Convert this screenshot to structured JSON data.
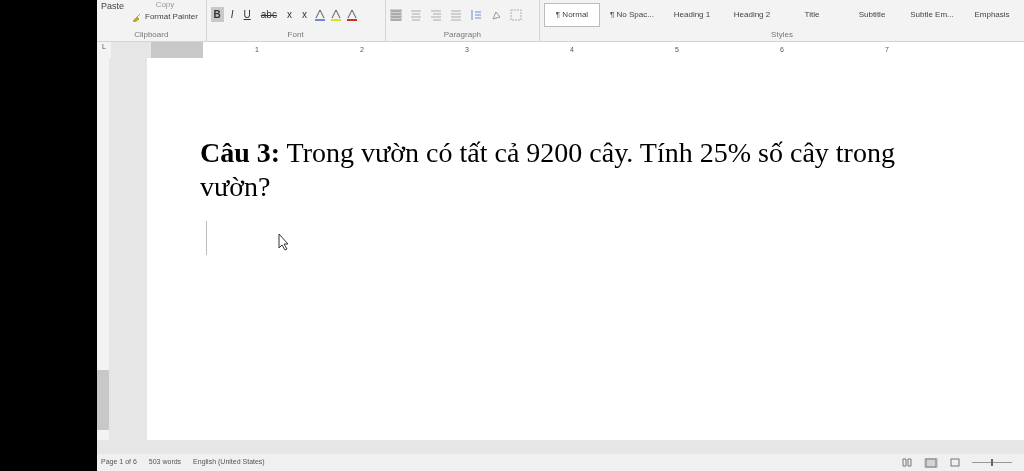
{
  "clipboard": {
    "paste": "Paste",
    "copy": "Copy",
    "format_painter": "Format Painter",
    "label": "Clipboard"
  },
  "font": {
    "buttons": [
      {
        "text": "B",
        "kind": "bold",
        "selected": true
      },
      {
        "text": "I",
        "kind": "italic",
        "selected": false
      },
      {
        "text": "U",
        "kind": "underline",
        "selected": false
      },
      {
        "text": "abc",
        "kind": "strike",
        "selected": false
      },
      {
        "text": "x",
        "kind": "sub",
        "selected": false
      },
      {
        "text": "x",
        "kind": "sup",
        "selected": false
      }
    ],
    "label": "Font"
  },
  "paragraph": {
    "label": "Paragraph"
  },
  "styles": {
    "items": [
      {
        "label": "¶ Normal",
        "selected": true
      },
      {
        "label": "¶ No Spac...",
        "selected": false
      },
      {
        "label": "Heading 1",
        "selected": false
      },
      {
        "label": "Heading 2",
        "selected": false
      },
      {
        "label": "Title",
        "selected": false
      },
      {
        "label": "Subtitle",
        "selected": false
      },
      {
        "label": "Subtle Em...",
        "selected": false
      },
      {
        "label": "Emphasis",
        "selected": false
      }
    ],
    "label": "Styles"
  },
  "tab_selector": "L",
  "zoom": {
    "level": 0.5
  },
  "ruler": [
    "1",
    "2",
    "3",
    "4",
    "5",
    "6",
    "7"
  ],
  "document": {
    "paragraph": "**Câu 3:** Trong vườn có tất cả 9200 cây. Tính 25% số cây trong vườn?"
  },
  "status_bar": {
    "page": "Page 1 of 6",
    "words": "503 words",
    "language": "English (United States)"
  }
}
